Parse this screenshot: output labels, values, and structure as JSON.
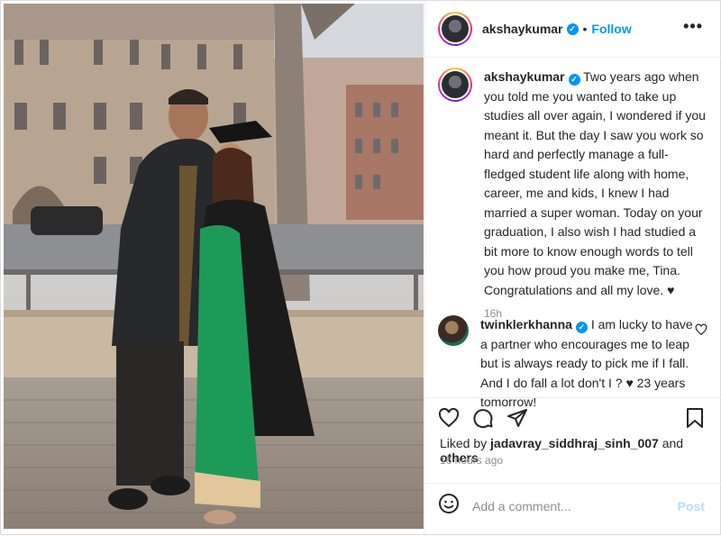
{
  "post": {
    "author": "akshaykumar",
    "follow_label": "Follow",
    "more_label": "•••",
    "dot": "•",
    "verified_mark": "✓",
    "caption": "Two years ago when you told me you wanted to take up studies all over again, I wondered if you meant it. But the day I saw you work so hard and perfectly manage a full-fledged student life along with home, career, me and kids, I knew I had married a super woman. Today on your graduation, I also wish I had studied a bit more to know enough words to tell you how proud you make me, Tina. Congratulations and all my love. ♥",
    "caption_time": "16h"
  },
  "comments": [
    {
      "author": "twinklerkhanna",
      "text": "I am lucky to have a partner who encourages me to leap but is always ready to pick me if I fall. And I do fall a lot don't I ? ♥ 23 years tomorrow!"
    }
  ],
  "likes": {
    "prefix": "Liked by",
    "user": "jadavray_siddhraj_sinh_007",
    "joiner": "and",
    "others": "others"
  },
  "posted_ago": "16 hours ago",
  "add_comment": {
    "placeholder": "Add a comment...",
    "post_label": "Post"
  },
  "icons": {
    "like": "heart-icon",
    "comment": "comment-icon",
    "share": "paper-plane-icon",
    "save": "bookmark-icon",
    "emoji": "emoji-smile-icon",
    "comment_like": "heart-outline-icon"
  },
  "colors": {
    "link": "#0095f6",
    "muted": "#8e8e8e",
    "post_disabled": "#b2dffc"
  }
}
